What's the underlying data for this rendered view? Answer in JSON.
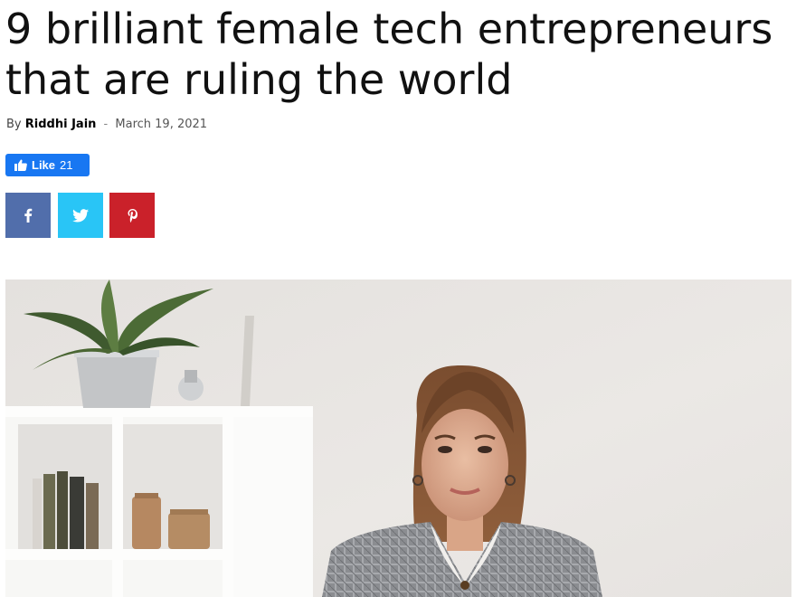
{
  "article": {
    "title_line1": "9 brilliant female tech entrepreneurs",
    "title_line2": "that are ruling the world",
    "by_label": "By",
    "author": "Riddhi Jain",
    "separator": "-",
    "date": "March 19, 2021"
  },
  "like": {
    "label": "Like",
    "count": "21",
    "color": "#1877f2"
  },
  "share": [
    {
      "name": "facebook",
      "icon": "facebook-icon",
      "color": "#516eab"
    },
    {
      "name": "twitter",
      "icon": "twitter-icon",
      "color": "#29c5f6"
    },
    {
      "name": "pinterest",
      "icon": "pinterest-icon",
      "color": "#ca212a"
    }
  ],
  "hero_image": {
    "subject": "woman-at-desk-photo"
  }
}
